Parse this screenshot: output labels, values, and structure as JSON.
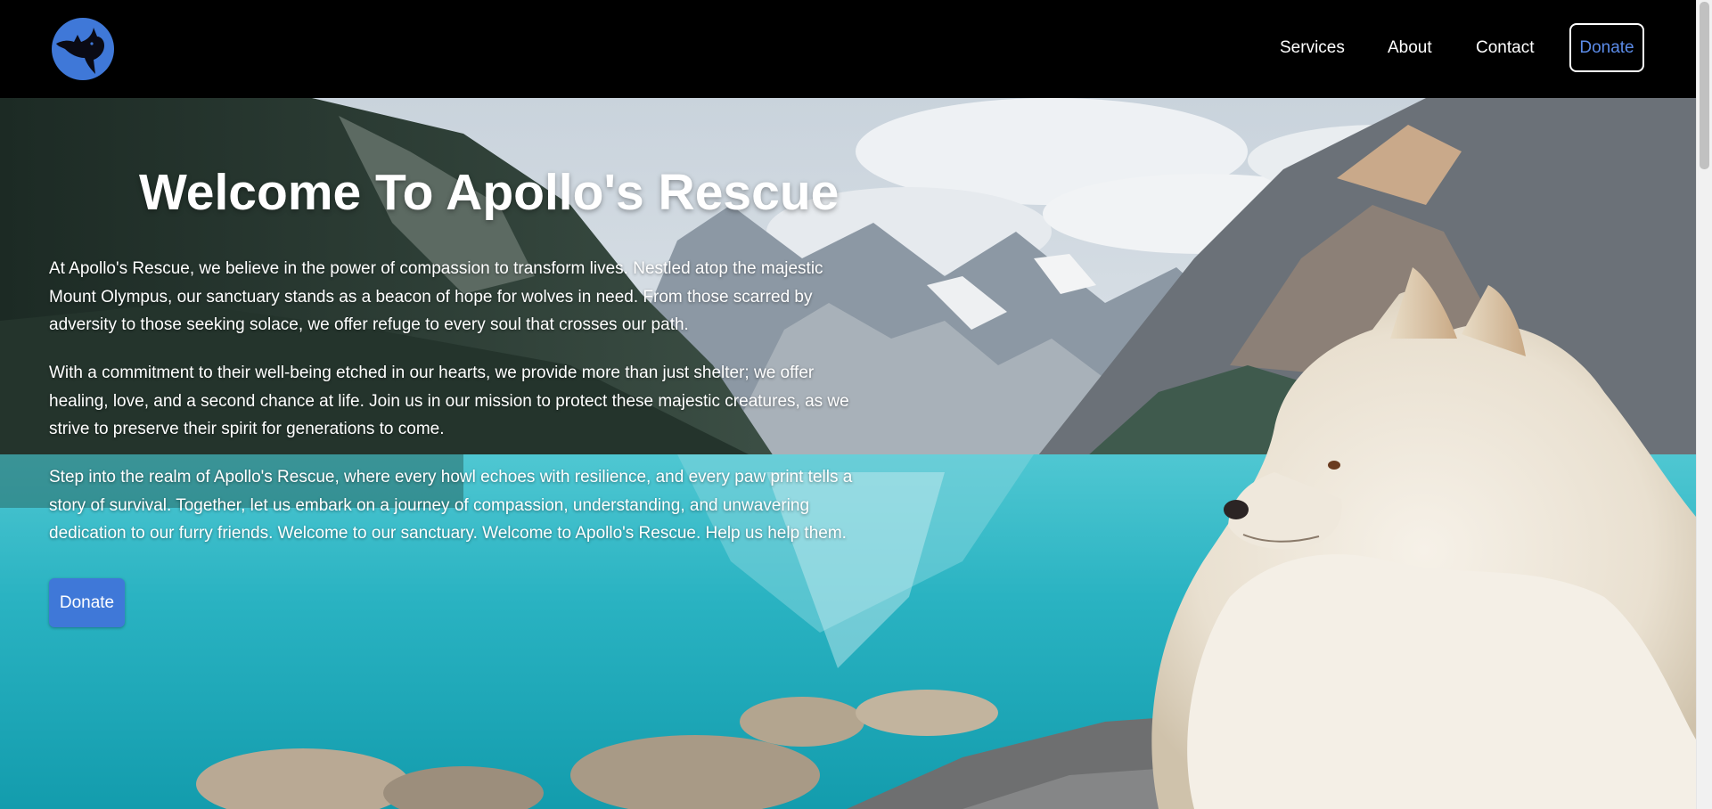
{
  "nav": {
    "services": "Services",
    "about": "About",
    "contact": "Contact",
    "donate": "Donate"
  },
  "hero": {
    "title": "Welcome To Apollo's Rescue",
    "paragraph_1_line_1": "At Apollo's Rescue, we believe in the power of compassion to transform lives. Nestled atop the majestic",
    "paragraph_1_line_2": "Mount Olympus, our sanctuary stands as a beacon of hope for wolves in need. From those scarred by",
    "paragraph_1_line_3": "adversity to those seeking solace, we offer refuge to every soul that crosses our path.",
    "paragraph_2_line_1": "With a commitment to their well-being etched in our hearts, we provide more than just shelter; we offer",
    "paragraph_2_line_2": "healing, love, and a second chance at life. Join us in our mission to protect these majestic creatures, as we",
    "paragraph_2_line_3": "strive to preserve their spirit for generations to come.",
    "paragraph_3_line_1": "Step into the realm of Apollo's Rescue, where every howl echoes with resilience, and every paw print tells a",
    "paragraph_3_line_2": "story of survival. Together, let us embark on a journey of compassion, understanding, and unwavering",
    "paragraph_3_line_3": "dedication to our furry friends. Welcome to our sanctuary. Welcome to Apollo's Rescue. Help us help them.",
    "donate_button": "Donate"
  },
  "icons": {
    "logo": "wolf-head-logo-icon"
  },
  "colors": {
    "header_bg": "#000000",
    "accent": "#3f78d8",
    "nav_donate_text": "#5b8be8",
    "text": "#ffffff"
  }
}
